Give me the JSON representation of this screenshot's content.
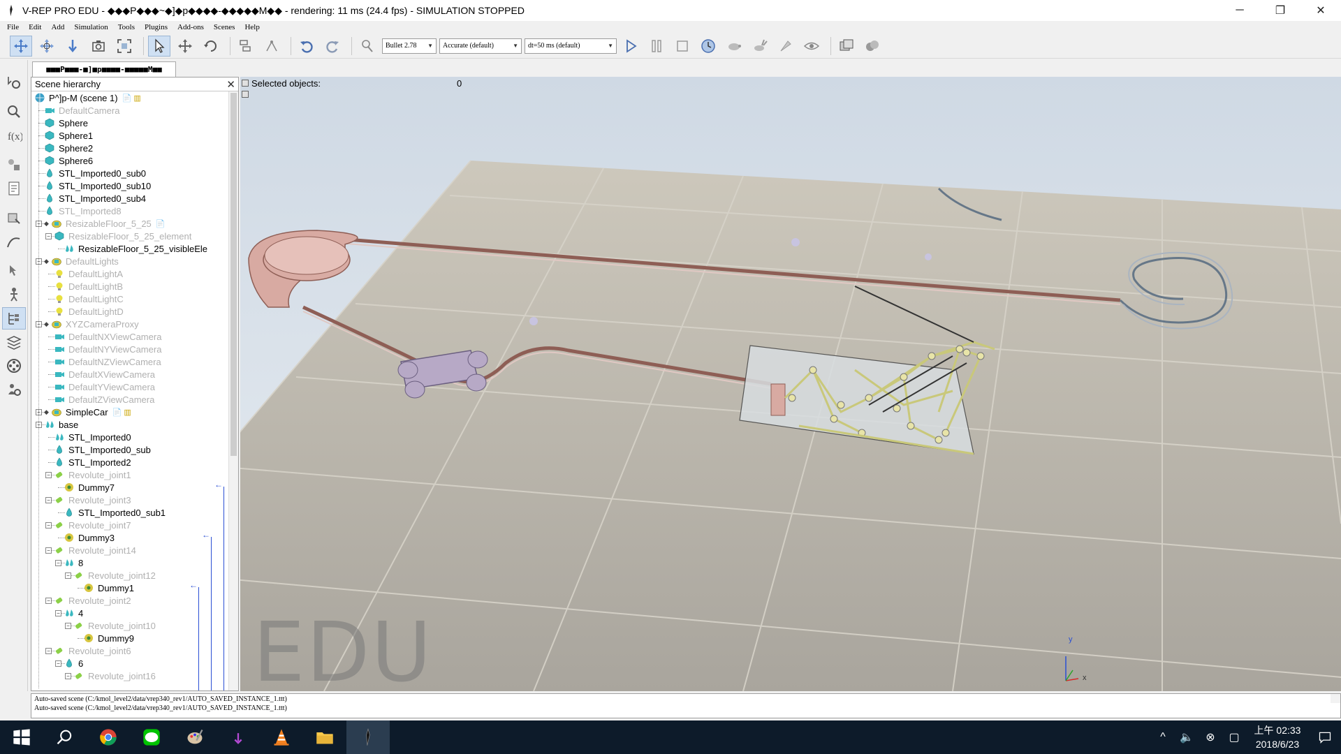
{
  "window": {
    "title": "V-REP PRO EDU - ◆◆◆P◆◆◆~◆]◆p◆◆◆◆-◆◆◆◆◆M◆◆ - rendering: 11 ms (24.4 fps) - SIMULATION STOPPED",
    "minimize": "─",
    "restore": "❐",
    "close": "✕"
  },
  "menu": [
    "File",
    "Edit",
    "Add",
    "Simulation",
    "Tools",
    "Plugins",
    "Add-ons",
    "Scenes",
    "Help"
  ],
  "toolbar": {
    "engine": "Bullet 2.78",
    "accuracy": "Accurate (default)",
    "timestep": "dt=50 ms (default)"
  },
  "scene_tab": "■■■P■■■-■]■p■■■■-■■■■■M■■",
  "hierarchy": {
    "title": "Scene hierarchy",
    "close": "✕",
    "rows": [
      {
        "label": "P^]p-M (scene 1)",
        "icon": "world-icon",
        "depth": 0,
        "dim": false,
        "expander": "",
        "scripts": "📄 ▥"
      },
      {
        "label": "DefaultCamera",
        "icon": "camera-icon",
        "depth": 1,
        "dim": true,
        "expander": ""
      },
      {
        "label": "Sphere",
        "icon": "shape-icon",
        "depth": 1,
        "dim": false,
        "expander": ""
      },
      {
        "label": "Sphere1",
        "icon": "shape-icon",
        "depth": 1,
        "dim": false,
        "expander": ""
      },
      {
        "label": "Sphere2",
        "icon": "shape-icon",
        "depth": 1,
        "dim": false,
        "expander": ""
      },
      {
        "label": "Sphere6",
        "icon": "shape-icon",
        "depth": 1,
        "dim": false,
        "expander": ""
      },
      {
        "label": "STL_Imported0_sub0",
        "icon": "drop-shape-icon",
        "depth": 1,
        "dim": false,
        "expander": ""
      },
      {
        "label": "STL_Imported0_sub10",
        "icon": "drop-shape-icon",
        "depth": 1,
        "dim": false,
        "expander": ""
      },
      {
        "label": "STL_Imported0_sub4",
        "icon": "drop-shape-icon",
        "depth": 1,
        "dim": false,
        "expander": ""
      },
      {
        "label": "STL_Imported8",
        "icon": "drop-shape-icon",
        "depth": 1,
        "dim": true,
        "expander": ""
      },
      {
        "label": "ResizableFloor_5_25",
        "icon": "model-icon",
        "depth": 1,
        "dim": true,
        "expander": "−",
        "scripts": "📄"
      },
      {
        "label": "ResizableFloor_5_25_element",
        "icon": "shape-icon",
        "depth": 2,
        "dim": true,
        "expander": "−"
      },
      {
        "label": "ResizableFloor_5_25_visibleEle",
        "icon": "multi-shape-icon",
        "depth": 3,
        "dim": false,
        "expander": ""
      },
      {
        "label": "DefaultLights",
        "icon": "model-icon",
        "depth": 1,
        "dim": true,
        "expander": "−"
      },
      {
        "label": "DefaultLightA",
        "icon": "light-icon",
        "depth": 2,
        "dim": true,
        "expander": ""
      },
      {
        "label": "DefaultLightB",
        "icon": "light-icon",
        "depth": 2,
        "dim": true,
        "expander": ""
      },
      {
        "label": "DefaultLightC",
        "icon": "light-icon",
        "depth": 2,
        "dim": true,
        "expander": ""
      },
      {
        "label": "DefaultLightD",
        "icon": "light-icon",
        "depth": 2,
        "dim": true,
        "expander": ""
      },
      {
        "label": "XYZCameraProxy",
        "icon": "model-icon",
        "depth": 1,
        "dim": true,
        "expander": "−"
      },
      {
        "label": "DefaultNXViewCamera",
        "icon": "camera-icon",
        "depth": 2,
        "dim": true,
        "expander": ""
      },
      {
        "label": "DefaultNYViewCamera",
        "icon": "camera-icon",
        "depth": 2,
        "dim": true,
        "expander": ""
      },
      {
        "label": "DefaultNZViewCamera",
        "icon": "camera-icon",
        "depth": 2,
        "dim": true,
        "expander": ""
      },
      {
        "label": "DefaultXViewCamera",
        "icon": "camera-icon",
        "depth": 2,
        "dim": true,
        "expander": ""
      },
      {
        "label": "DefaultYViewCamera",
        "icon": "camera-icon",
        "depth": 2,
        "dim": true,
        "expander": ""
      },
      {
        "label": "DefaultZViewCamera",
        "icon": "camera-icon",
        "depth": 2,
        "dim": true,
        "expander": ""
      },
      {
        "label": "SimpleCar",
        "icon": "model-icon",
        "depth": 1,
        "dim": false,
        "expander": "+",
        "scripts": "📄 ▥"
      },
      {
        "label": "base",
        "icon": "multi-shape-icon",
        "depth": 1,
        "dim": false,
        "expander": "−"
      },
      {
        "label": "STL_Imported0",
        "icon": "multi-shape-icon",
        "depth": 2,
        "dim": false,
        "expander": ""
      },
      {
        "label": "STL_Imported0_sub",
        "icon": "drop-shape-icon",
        "depth": 2,
        "dim": false,
        "expander": ""
      },
      {
        "label": "STL_Imported2",
        "icon": "drop-shape-icon",
        "depth": 2,
        "dim": false,
        "expander": ""
      },
      {
        "label": "Revolute_joint1",
        "icon": "joint-icon",
        "depth": 2,
        "dim": true,
        "expander": "−"
      },
      {
        "label": "Dummy7",
        "icon": "dummy-icon",
        "depth": 3,
        "dim": false,
        "expander": ""
      },
      {
        "label": "Revolute_joint3",
        "icon": "joint-icon",
        "depth": 2,
        "dim": true,
        "expander": "−"
      },
      {
        "label": "STL_Imported0_sub1",
        "icon": "drop-shape-icon",
        "depth": 3,
        "dim": false,
        "expander": ""
      },
      {
        "label": "Revolute_joint7",
        "icon": "joint-icon",
        "depth": 2,
        "dim": true,
        "expander": "−"
      },
      {
        "label": "Dummy3",
        "icon": "dummy-icon",
        "depth": 3,
        "dim": false,
        "expander": ""
      },
      {
        "label": "Revolute_joint14",
        "icon": "joint-icon",
        "depth": 2,
        "dim": true,
        "expander": "−"
      },
      {
        "label": "8",
        "icon": "multi-shape-icon",
        "depth": 3,
        "dim": false,
        "expander": "−"
      },
      {
        "label": "Revolute_joint12",
        "icon": "joint-icon",
        "depth": 4,
        "dim": true,
        "expander": "−"
      },
      {
        "label": "Dummy1",
        "icon": "dummy-icon",
        "depth": 5,
        "dim": false,
        "expander": ""
      },
      {
        "label": "Revolute_joint2",
        "icon": "joint-icon",
        "depth": 2,
        "dim": true,
        "expander": "−"
      },
      {
        "label": "4",
        "icon": "multi-shape-icon",
        "depth": 3,
        "dim": false,
        "expander": "−"
      },
      {
        "label": "Revolute_joint10",
        "icon": "joint-icon",
        "depth": 4,
        "dim": true,
        "expander": "−"
      },
      {
        "label": "Dummy9",
        "icon": "dummy-icon",
        "depth": 5,
        "dim": false,
        "expander": ""
      },
      {
        "label": "Revolute_joint6",
        "icon": "joint-icon",
        "depth": 2,
        "dim": true,
        "expander": "−"
      },
      {
        "label": "6",
        "icon": "drop-shape-icon",
        "depth": 3,
        "dim": false,
        "expander": "−"
      },
      {
        "label": "Revolute_joint16",
        "icon": "joint-icon",
        "depth": 4,
        "dim": true,
        "expander": "−"
      }
    ]
  },
  "viewport": {
    "selected_label": "Selected objects:",
    "selected_count": "0",
    "watermark": "EDU",
    "axis_y": "y",
    "axis_x": "x"
  },
  "status": {
    "lines": [
      "Auto-saved scene (C:/kmol_level2/data/vrep340_rev1/AUTO_SAVED_INSTANCE_1.ttt)",
      "Auto-saved scene (C:/kmol_level2/data/vrep340_rev1/AUTO_SAVED_INSTANCE_1.ttt)"
    ]
  },
  "taskbar": {
    "clock_time": "上午 02:33",
    "clock_date": "2018/6/23",
    "tray": [
      "^",
      "🔈",
      "⊗",
      "▢"
    ]
  },
  "colors": {
    "accent": "#cfe0f3",
    "taskbar": "#0d1b2a",
    "link": "#2a4fd4"
  }
}
